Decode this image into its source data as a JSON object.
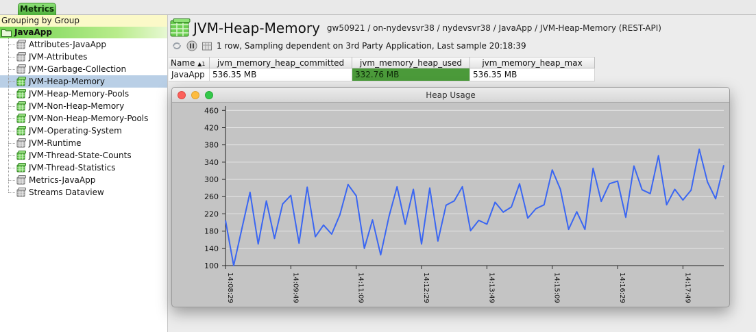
{
  "tabs": {
    "metrics_label": "Metrics"
  },
  "tree": {
    "group_header": "Grouping by Group",
    "root_label": "JavaApp",
    "items": [
      {
        "label": "Attributes-JavaApp",
        "icon": "gray-db-icon"
      },
      {
        "label": "JVM-Attributes",
        "icon": "gray-db-icon"
      },
      {
        "label": "JVM-Garbage-Collection",
        "icon": "gray-db-icon"
      },
      {
        "label": "JVM-Heap-Memory",
        "icon": "green-db-icon",
        "selected": true
      },
      {
        "label": "JVM-Heap-Memory-Pools",
        "icon": "green-db-icon"
      },
      {
        "label": "JVM-Non-Heap-Memory",
        "icon": "green-db-icon"
      },
      {
        "label": "JVM-Non-Heap-Memory-Pools",
        "icon": "green-db-icon"
      },
      {
        "label": "JVM-Operating-System",
        "icon": "green-db-icon"
      },
      {
        "label": "JVM-Runtime",
        "icon": "gray-db-icon"
      },
      {
        "label": "JVM-Thread-State-Counts",
        "icon": "green-db-icon"
      },
      {
        "label": "JVM-Thread-Statistics",
        "icon": "green-db-icon"
      },
      {
        "label": "Metrics-JavaApp",
        "icon": "gray-db-icon"
      },
      {
        "label": "Streams Dataview",
        "icon": "gray-db-icon"
      }
    ]
  },
  "header": {
    "title": "JVM-Heap-Memory",
    "path": "gw50921 / on-nydevsvr38 / nydevsvr38 / JavaApp / JVM-Heap-Memory (REST-API)",
    "status": "1 row, Sampling dependent on 3rd Party Application, Last sample 20:18:39"
  },
  "table": {
    "columns": [
      "Name",
      "jvm_memory_heap_committed",
      "jvm_memory_heap_used",
      "jvm_memory_heap_max"
    ],
    "sort_indicator": "▲1",
    "rows": [
      [
        "JavaApp",
        "536.35 MB",
        "332.76 MB",
        "536.35 MB"
      ]
    ]
  },
  "colors": {
    "accent_green": "#4b9a3a",
    "series_line": "#3a66f2",
    "selection": "#b9cfe6"
  },
  "chart_window": {
    "title": "Heap Usage"
  },
  "chart_data": {
    "type": "line",
    "title": "",
    "xlabel": "",
    "ylabel": "",
    "ylim": [
      100,
      470
    ],
    "yticks": [
      100,
      140,
      180,
      220,
      260,
      300,
      340,
      380,
      420,
      460
    ],
    "xtick_labels": [
      "14:08:29",
      "14:09:49",
      "14:11:09",
      "14:12:29",
      "14:13:49",
      "14:15:09",
      "14:16:29",
      "14:17:49"
    ],
    "grid": true,
    "series": [
      {
        "values": [
          205,
          100,
          185,
          270,
          150,
          250,
          163,
          243,
          263,
          152,
          282,
          167,
          194,
          173,
          218,
          288,
          262,
          140,
          206,
          125,
          213,
          283,
          196,
          277,
          150,
          280,
          157,
          240,
          250,
          283,
          181,
          205,
          196,
          247,
          224,
          236,
          290,
          210,
          232,
          241,
          322,
          277,
          184,
          225,
          184,
          326,
          249,
          290,
          296,
          212,
          331,
          276,
          267,
          355,
          241,
          277,
          252,
          275,
          370,
          294,
          255,
          333
        ]
      }
    ]
  }
}
